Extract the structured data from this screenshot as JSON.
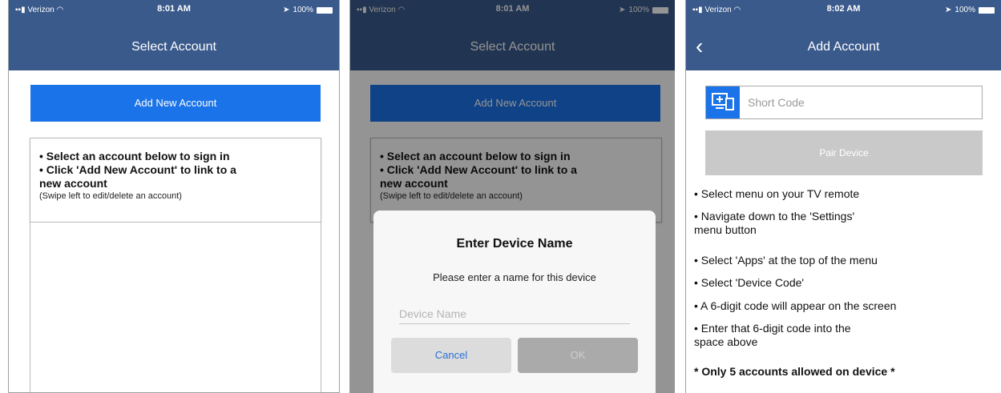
{
  "status": {
    "carrier": "Verizon",
    "battery": "100%",
    "time_a": "8:01 AM",
    "time_b": "8:02 AM"
  },
  "screen1": {
    "title": "Select Account",
    "add_button": "Add New Account",
    "bullets": [
      "• Select an account below to sign in",
      "• Click 'Add New Account' to link to a",
      "new account"
    ],
    "hint": "(Swipe left to edit/delete an account)"
  },
  "dialog": {
    "title": "Enter Device Name",
    "message": "Please enter a name for this device",
    "placeholder": "Device Name",
    "cancel": "Cancel",
    "ok": "OK"
  },
  "screen3": {
    "title": "Add Account",
    "code_placeholder": "Short Code",
    "pair_button": "Pair Device",
    "instructions": [
      "• Select menu on your TV remote",
      "• Navigate down to the 'Settings'",
      "menu button",
      "• Select 'Apps' at the top of the menu",
      "• Select 'Device Code'",
      "• A 6-digit code will appear on the screen",
      "• Enter that 6-digit code into the",
      "space above"
    ],
    "note": "* Only 5 accounts allowed on device *"
  },
  "colors": {
    "nav": "#3a5a8c",
    "accent": "#1a73e8",
    "disabled": "#c9c9c9"
  },
  "icons": [
    "wifi-icon",
    "location-arrow-icon",
    "battery-icon",
    "back-chevron-icon",
    "tv-device-icon"
  ]
}
